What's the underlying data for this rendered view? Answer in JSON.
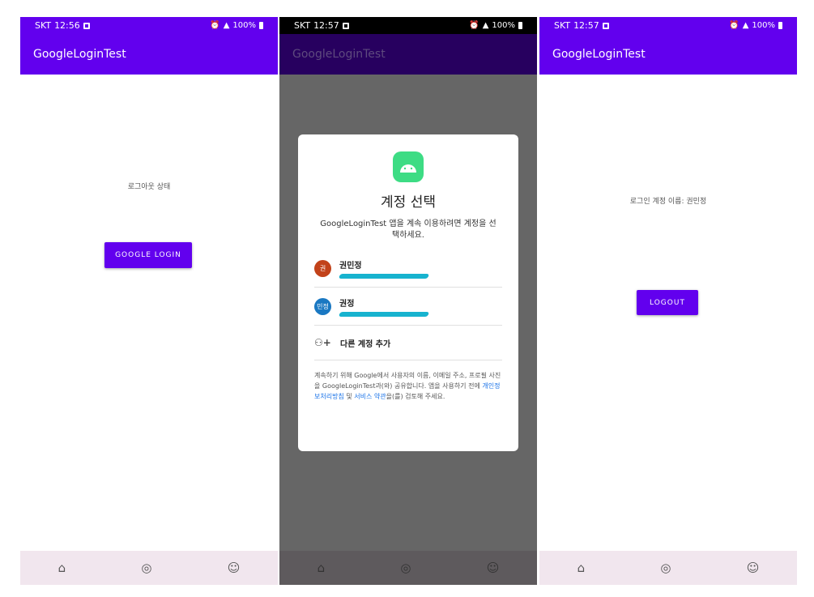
{
  "status_bars": [
    {
      "carrier": "SKT",
      "time": "12:56",
      "battery": "100%"
    },
    {
      "carrier": "SKT",
      "time": "12:57",
      "battery": "100%"
    },
    {
      "carrier": "SKT",
      "time": "12:57",
      "battery": "100%"
    }
  ],
  "app_title": "GoogleLoginTest",
  "screen1": {
    "status_text": "로그아웃 상태",
    "button_label": "GOOGLE LOGIN"
  },
  "screen2": {
    "dialog_title": "계정 선택",
    "dialog_subtitle": "GoogleLoginTest 앱을 계속 이용하려면 계정을 선택하세요.",
    "accounts": [
      {
        "avatar": "권",
        "name": "권민정",
        "avatar_color": "#c2421a"
      },
      {
        "avatar": "민정",
        "name": "권정",
        "avatar_color": "#1a78c2"
      }
    ],
    "add_account": "다른 계정 추가",
    "legal_1": "계속하기 위해 Google에서 사용자의 이름, 이메일 주소, 프로필 사진을 GoogleLoginTest과(와) 공유합니다. 앱을 사용하기 전에 ",
    "privacy_link": "개인정보처리방침",
    "legal_2": " 및 ",
    "terms_link": "서비스 약관",
    "legal_3": "을(를) 검토해 주세요."
  },
  "screen3": {
    "status_text": "로그인 계정 이름: 권민정",
    "button_label": "LOGOUT"
  },
  "nav_icons": [
    "home-icon",
    "dish-icon",
    "profile-icon"
  ],
  "colors": {
    "primary": "#6200ee",
    "scrim": "#666666",
    "nav_bg": "#f1e6ee",
    "link": "#1a73e8"
  }
}
